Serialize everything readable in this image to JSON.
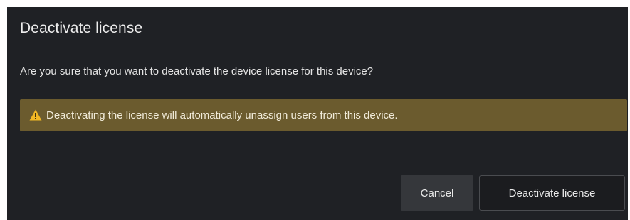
{
  "dialog": {
    "title": "Deactivate license",
    "message": "Are you sure that you want to deactivate the device license for this device?",
    "warning": {
      "icon": "warning-triangle-icon",
      "text": "Deactivating the license will automatically unassign users from this device."
    },
    "buttons": {
      "cancel_label": "Cancel",
      "confirm_label": "Deactivate license"
    }
  },
  "colors": {
    "dialog_background": "#1f2125",
    "warning_background": "#6b5b2e",
    "warning_icon": "#f2b824"
  }
}
